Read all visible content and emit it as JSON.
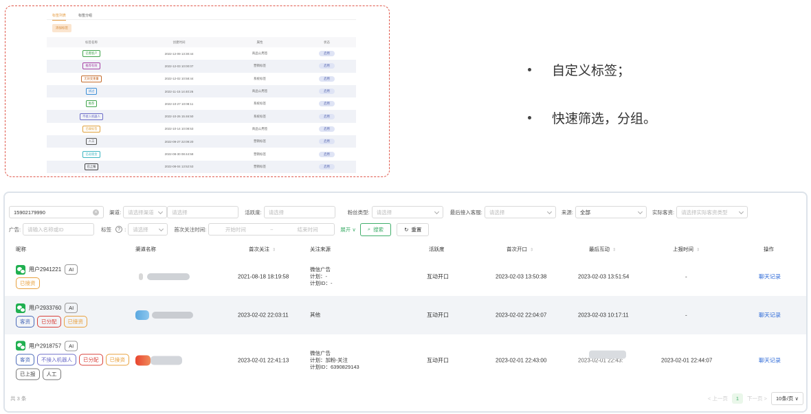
{
  "inset": {
    "tabs": [
      "标签列表",
      "标签分组"
    ],
    "add_button": "添加标签",
    "headers": [
      "标签名称",
      "创建时间",
      "属性",
      "状态"
    ],
    "rows": [
      {
        "tag": "已需客户",
        "time": "2022-12-09 13:30:44",
        "attr": "商品公用签",
        "status": "启用",
        "color": "#3fa34a"
      },
      {
        "tag": "推荐有效",
        "time": "2022-12-03 10:00:07",
        "attr": "营销标签",
        "status": "启用",
        "color": "#a63fa3"
      },
      {
        "tag": "无效变重量",
        "time": "2022-12-02 10:58:44",
        "attr": "系统标签",
        "status": "启用",
        "color": "#c46a2a"
      },
      {
        "tag": "试过",
        "time": "2022-11-15 14:40:26",
        "attr": "商品公用签",
        "status": "启用",
        "color": "#3a8ed6"
      },
      {
        "tag": "推荐",
        "time": "2022-10-27 10:08:11",
        "attr": "系统标签",
        "status": "启用",
        "color": "#3fa34a"
      },
      {
        "tag": "不接入机器人",
        "time": "2022-10-26 15:46:50",
        "attr": "系统标签",
        "status": "启用",
        "color": "#6c6cc8"
      },
      {
        "tag": "已拨标签",
        "time": "2022-10-14 10:08:53",
        "attr": "商品公用签",
        "status": "启用",
        "color": "#e0a03a"
      },
      {
        "tag": "人工",
        "time": "2022-09-27 22:09:20",
        "attr": "营销标签",
        "status": "启用",
        "color": "#555555"
      },
      {
        "tag": "已返现金",
        "time": "2022-08-30 08:44:58",
        "attr": "营销标签",
        "status": "启用",
        "color": "#3ab5c0"
      },
      {
        "tag": "已上报",
        "time": "2022-08-04 13:52:53",
        "attr": "营销标签",
        "status": "启用",
        "color": "#444444"
      }
    ]
  },
  "bullets": [
    "自定义标签；",
    "快速筛选，分组。"
  ],
  "filters": {
    "search_value": "15902179990",
    "channel_label": "渠道:",
    "channel_placeholder": "请选择渠道",
    "channel2_placeholder": "请选择",
    "activity_label": "活跃度:",
    "activity_placeholder": "请选择",
    "fans_label": "粉丝类型:",
    "fans_placeholder": "请选择",
    "last_service_label": "最后接入客服:",
    "last_service_placeholder": "请选择",
    "source_label": "来源:",
    "source_value": "全部",
    "actual_label": "实际客资:",
    "actual_placeholder": "请选择实际客资类型",
    "ad_label": "广告:",
    "ad_placeholder": "请输入名称或ID",
    "tag_label": "标签",
    "tag_placeholder": "请选择",
    "first_follow_label": "首次关注时间:",
    "start_placeholder": "开始时间",
    "range_sep": "~",
    "end_placeholder": "结束时间",
    "expand": "展开",
    "search_button": "搜索",
    "reset_button": "重置"
  },
  "table": {
    "headers": {
      "nick": "昵称",
      "channel": "渠道名称",
      "first_follow": "首次关注",
      "source": "关注来源",
      "activity": "活跃度",
      "first_open": "首次开口",
      "last_interact": "最后互动",
      "report_time": "上报时间",
      "action": "操作"
    },
    "rows": [
      {
        "nick": "用户2941221",
        "ai": "AI",
        "tags": [
          {
            "text": "已接资",
            "style": "orange"
          }
        ],
        "first_follow": "2021-08-18 18:19:58",
        "source_lines": [
          "微信广告",
          "计划：-",
          "计划ID：-"
        ],
        "activity": "互动开口",
        "first_open": "2023-02-03 13:50:38",
        "last_interact": "2023-02-03 13:51:54",
        "report_time": "-",
        "action": "聊天记录"
      },
      {
        "nick": "用户2933760",
        "ai": "AI",
        "tags": [
          {
            "text": "客资",
            "style": "blue"
          },
          {
            "text": "已分配",
            "style": "red"
          },
          {
            "text": "已接资",
            "style": "orange"
          }
        ],
        "first_follow": "2023-02-02 22:03:11",
        "source_lines": [
          "其他"
        ],
        "activity": "互动开口",
        "first_open": "2023-02-02 22:04:07",
        "last_interact": "2023-02-03 10:17:11",
        "report_time": "-",
        "action": "聊天记录"
      },
      {
        "nick": "用户2918757",
        "ai": "AI",
        "tags": [
          {
            "text": "客资",
            "style": "blue"
          },
          {
            "text": "不接入机器人",
            "style": "purple"
          },
          {
            "text": "已分配",
            "style": "red"
          },
          {
            "text": "已接资",
            "style": "orange"
          }
        ],
        "tags2": [
          {
            "text": "已上报",
            "style": "gray"
          },
          {
            "text": "人工",
            "style": "gray"
          }
        ],
        "first_follow": "2023-02-01 22:41:13",
        "source_lines": [
          "微信广告",
          "计划：加粉-关注",
          "计划ID：6390829143"
        ],
        "activity": "互动开口",
        "first_open": "2023-02-01 22:43:00",
        "last_interact": "2023-02-01 22:43:",
        "report_time": "2023-02-01 22:44:07",
        "action": "聊天记录"
      }
    ]
  },
  "footer": {
    "total": "共 3 条",
    "prev": "< 上一页",
    "page": "1",
    "next": "下一页 >",
    "page_size": "10条/页"
  }
}
